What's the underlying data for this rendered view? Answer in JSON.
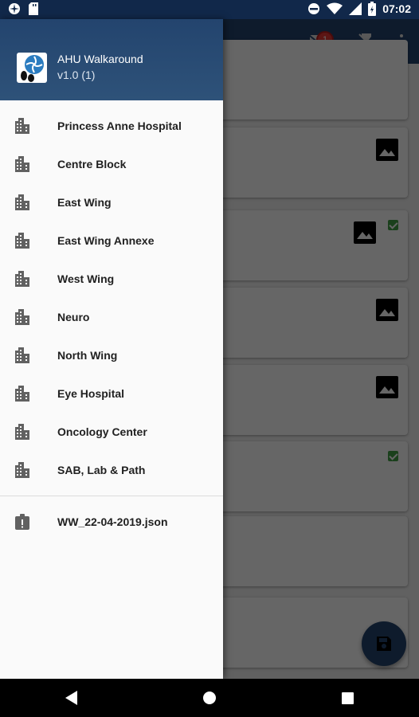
{
  "status_bar": {
    "time": "07:02",
    "icons": [
      "app-icon",
      "sd-card-icon",
      "do-not-disturb-icon",
      "wifi-icon",
      "signal-icon",
      "battery-icon"
    ]
  },
  "drawer": {
    "app_name": "AHU Walkaround",
    "app_version": "v1.0 (1)",
    "menu_items": [
      {
        "label": "Princess Anne Hospital",
        "icon": "building-icon"
      },
      {
        "label": "Centre Block",
        "icon": "building-icon"
      },
      {
        "label": "East Wing",
        "icon": "building-icon"
      },
      {
        "label": "East Wing Annexe",
        "icon": "building-icon"
      },
      {
        "label": "West Wing",
        "icon": "building-icon"
      },
      {
        "label": "Neuro",
        "icon": "building-icon"
      },
      {
        "label": "North Wing",
        "icon": "building-icon"
      },
      {
        "label": "Eye Hospital",
        "icon": "building-icon"
      },
      {
        "label": "Oncology Center",
        "icon": "building-icon"
      },
      {
        "label": "SAB, Lab & Path",
        "icon": "building-icon"
      }
    ],
    "file_item": {
      "label": "WW_22-04-2019.json",
      "icon": "clipboard-alert-icon"
    }
  },
  "background": {
    "message_badge_count": "1",
    "accent_color": "#23446e",
    "status_bar_color": "#11284a",
    "check_color": "#43a047",
    "badge_color": "#e53935"
  }
}
